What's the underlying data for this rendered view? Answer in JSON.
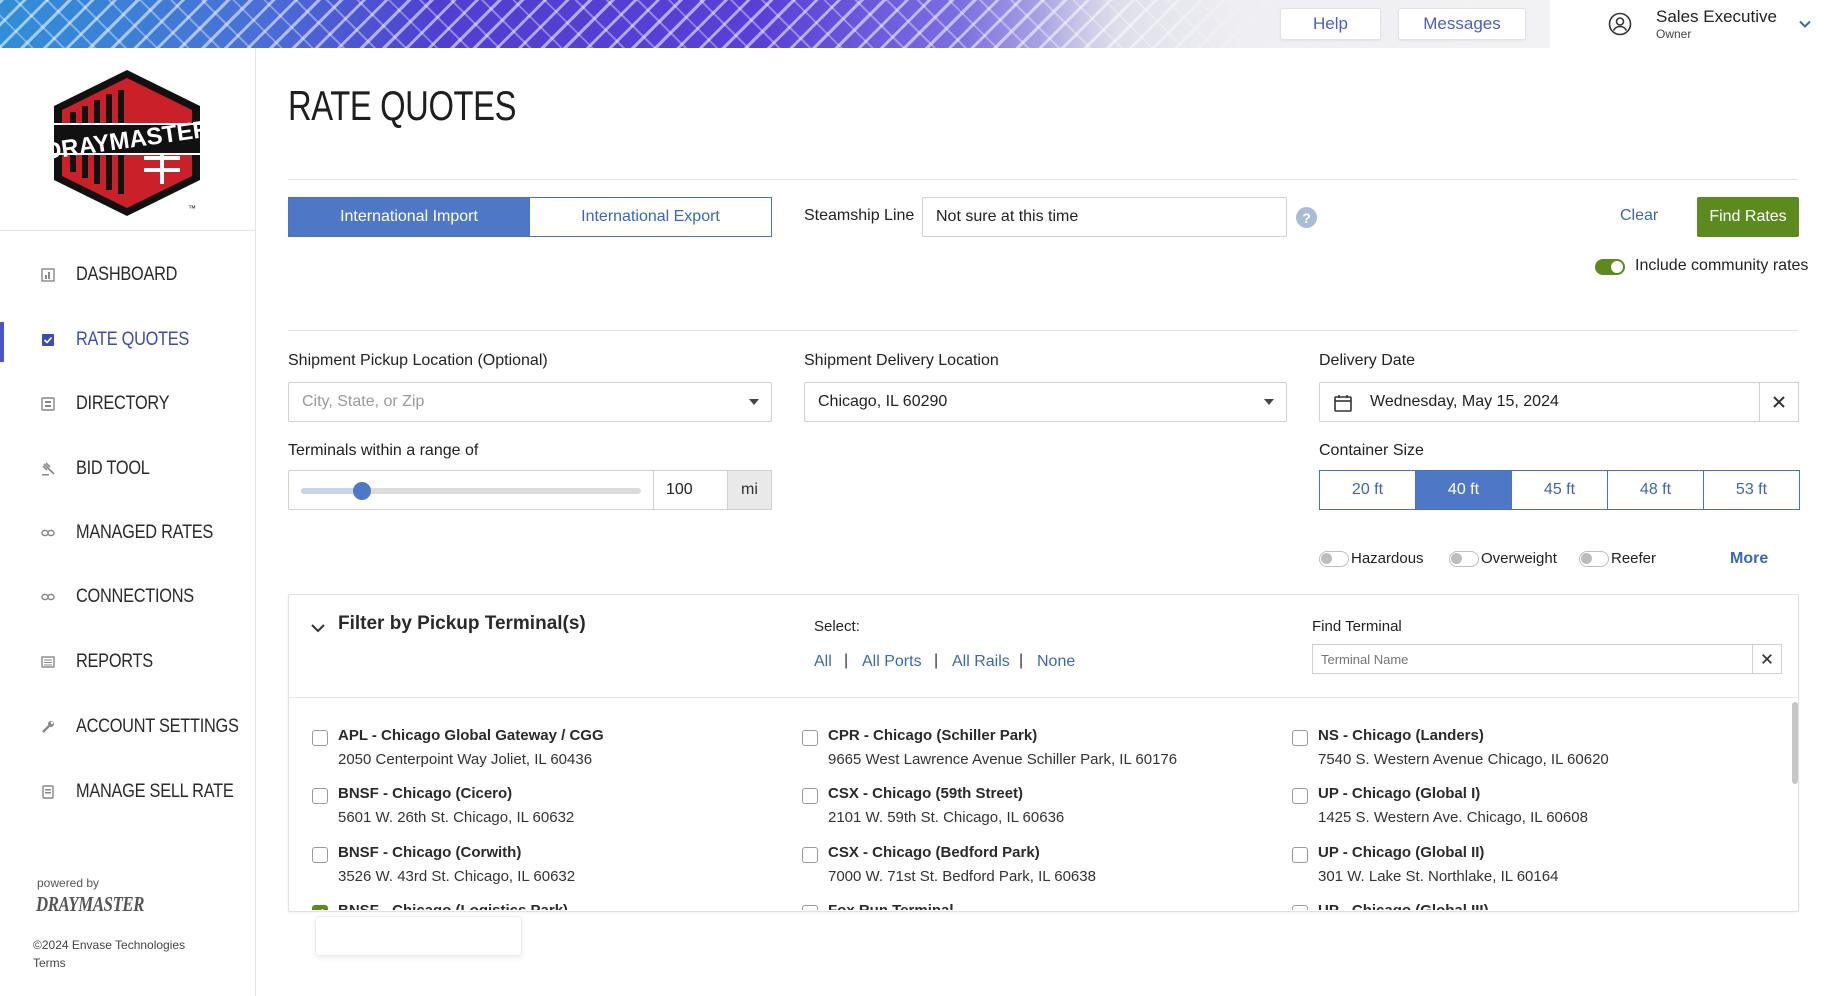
{
  "header": {
    "help_label": "Help",
    "messages_label": "Messages",
    "user": {
      "name": "Sales Executive",
      "role": "Owner"
    }
  },
  "sidebar": {
    "logo_text": "DRAYMASTER",
    "items": [
      {
        "label": "DASHBOARD",
        "icon": "dashboard-icon"
      },
      {
        "label": "RATE QUOTES",
        "icon": "rate-quotes-icon",
        "active": true
      },
      {
        "label": "DIRECTORY",
        "icon": "directory-icon"
      },
      {
        "label": "BID TOOL",
        "icon": "gavel-icon"
      },
      {
        "label": "MANAGED RATES",
        "icon": "link-icon"
      },
      {
        "label": "CONNECTIONS",
        "icon": "link-icon"
      },
      {
        "label": "REPORTS",
        "icon": "reports-icon"
      },
      {
        "label": "ACCOUNT SETTINGS",
        "icon": "wrench-icon"
      },
      {
        "label": "MANAGE SELL RATE",
        "icon": "document-icon"
      }
    ],
    "powered_by": "powered by",
    "powered_brand": "DRAYMASTER",
    "copyright": "©2024 Envase Technologies",
    "terms": "Terms"
  },
  "main": {
    "title": "RATE QUOTES",
    "direction_tabs": [
      "International Import",
      "International Export"
    ],
    "steamship_label": "Steamship Line",
    "steamship_value": "Not sure at this time",
    "clear_label": "Clear",
    "find_label": "Find Rates",
    "community_label": "Include community rates",
    "pickup_label": "Shipment Pickup Location (Optional)",
    "pickup_placeholder": "City, State, or Zip",
    "delivery_label": "Shipment Delivery Location",
    "delivery_value": "Chicago, IL 60290",
    "date_label": "Delivery Date",
    "date_value": "Wednesday, May 15, 2024",
    "range_label": "Terminals within a range of",
    "range_value": "100",
    "range_fraction": 0.18,
    "range_unit": "mi",
    "container_label": "Container Size",
    "container_sizes": [
      "20 ft",
      "40 ft",
      "45 ft",
      "48 ft",
      "53 ft"
    ],
    "container_selected": "40 ft",
    "options": [
      "Hazardous",
      "Overweight",
      "Reefer"
    ],
    "more_label": "More"
  },
  "filter": {
    "title": "Filter by Pickup Terminal(s)",
    "select_label": "Select:",
    "select_links": [
      "All",
      "All Ports",
      "All Rails",
      "None"
    ],
    "find_label": "Find Terminal",
    "find_placeholder": "Terminal Name",
    "terminals": [
      {
        "name": "APL - Chicago Global Gateway / CGG",
        "addr": "2050 Centerpoint Way Joliet, IL 60436",
        "checked": false
      },
      {
        "name": "CPR - Chicago (Schiller Park)",
        "addr": "9665 West Lawrence Avenue Schiller Park, IL 60176",
        "checked": false
      },
      {
        "name": "NS - Chicago (Landers)",
        "addr": "7540 S. Western Avenue Chicago, IL 60620",
        "checked": false
      },
      {
        "name": "BNSF - Chicago (Cicero)",
        "addr": "5601 W. 26th St. Chicago, IL 60632",
        "checked": false
      },
      {
        "name": "CSX - Chicago (59th Street)",
        "addr": "2101 W. 59th St. Chicago, IL 60636",
        "checked": false
      },
      {
        "name": "UP - Chicago (Global I)",
        "addr": "1425 S. Western Ave. Chicago, IL 60608",
        "checked": false
      },
      {
        "name": "BNSF - Chicago (Corwith)",
        "addr": "3526 W. 43rd St. Chicago, IL 60632",
        "checked": false
      },
      {
        "name": "CSX - Chicago (Bedford Park)",
        "addr": "7000 W. 71st St. Bedford Park, IL 60638",
        "checked": false
      },
      {
        "name": "UP - Chicago (Global II)",
        "addr": "301 W. Lake St. Northlake, IL 60164",
        "checked": false
      },
      {
        "name": "BNSF - Chicago (Logistics Park)",
        "addr": "",
        "checked": true
      },
      {
        "name": "Fox Run Terminal",
        "addr": "",
        "checked": false
      },
      {
        "name": "UP - Chicago (Global III)",
        "addr": "",
        "checked": false
      }
    ]
  },
  "colors": {
    "accent": "#4e78c6",
    "primary_button": "#5d8a1f",
    "nav_active": "#3d4bb8"
  }
}
